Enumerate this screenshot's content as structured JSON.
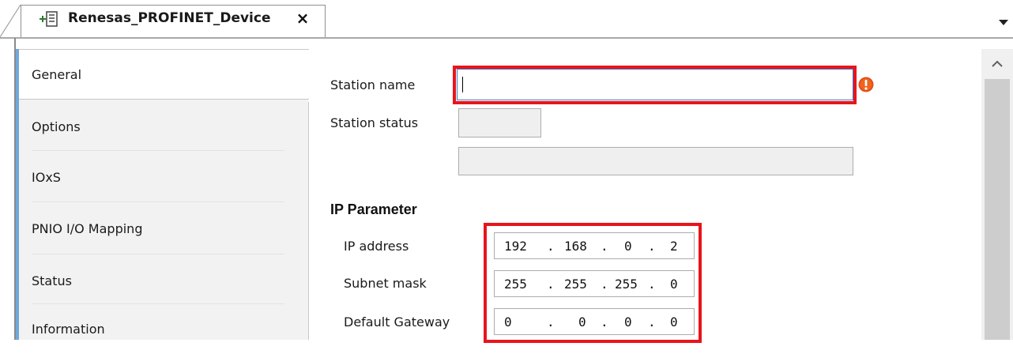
{
  "tab": {
    "title": "Renesas_PROFINET_Device",
    "close_label": "×",
    "icon": "device-tree-icon"
  },
  "nav": {
    "items": [
      {
        "label": "General",
        "selected": true
      },
      {
        "label": "Options",
        "selected": false
      },
      {
        "label": "IOxS",
        "selected": false
      },
      {
        "label": "PNIO I/O Mapping",
        "selected": false
      },
      {
        "label": "Status",
        "selected": false
      },
      {
        "label": "Information",
        "selected": false
      }
    ]
  },
  "form": {
    "station_name_label": "Station name",
    "station_name_value": "",
    "station_status_label": "Station status",
    "error_icon": "exclamation-error-icon"
  },
  "ip": {
    "section_title": "IP Parameter",
    "address_label": "IP address",
    "address": [
      "192",
      "168",
      "0",
      "2"
    ],
    "subnet_label": "Subnet mask",
    "subnet": [
      "255",
      "255",
      "255",
      "0"
    ],
    "gateway_label": "Default Gateway",
    "gateway": [
      "0",
      "0",
      "0",
      "0"
    ],
    "separator": "."
  },
  "colors": {
    "highlight": "#e8141b",
    "nav_accent": "#6fa8dc",
    "focus_border": "#3b78c4"
  }
}
